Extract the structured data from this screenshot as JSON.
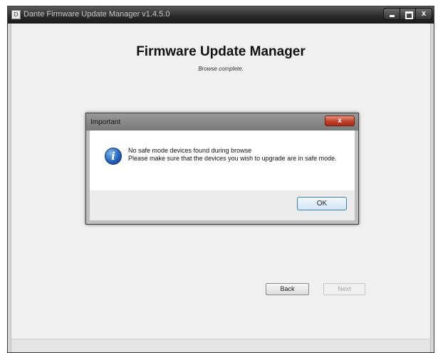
{
  "window": {
    "title": "Dante Firmware Update Manager v1.4.5.0",
    "icon_label": "D",
    "controls": {
      "minimize": "",
      "maximize": "",
      "close": "x"
    }
  },
  "main": {
    "heading": "Firmware Update Manager",
    "status": "Browse complete.",
    "back_label": "Back",
    "next_label": "Next"
  },
  "dialog": {
    "title": "Important",
    "close_symbol": "x",
    "icon_glyph": "i",
    "message_line1": "No safe mode devices found during browse",
    "message_line2": "Please make sure that the devices you wish to upgrade are in safe mode.",
    "ok_label": "OK"
  },
  "colors": {
    "titlebar": "#2c2c2c",
    "client_bg": "#f0f0f0",
    "dialog_close": "#c2402a",
    "info_icon": "#1f5fb8"
  }
}
